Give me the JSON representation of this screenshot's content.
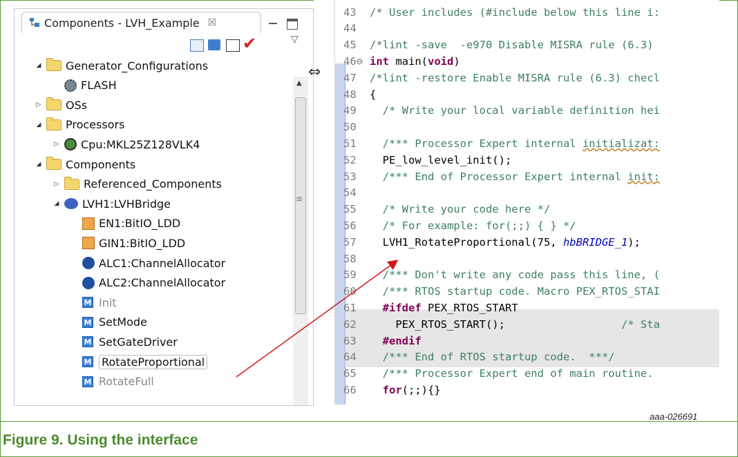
{
  "tab": {
    "title": "Components - LVH_Example",
    "close": "☒"
  },
  "toolbar": {
    "check": "✔",
    "menu": "▽"
  },
  "tree": [
    {
      "label": "Generator_Configurations",
      "type": "folder",
      "expand": "◢"
    },
    {
      "label": "FLASH",
      "type": "gear"
    },
    {
      "label": "OSs",
      "type": "folder",
      "expand": "▷"
    },
    {
      "label": "Processors",
      "type": "folder",
      "expand": "◢"
    },
    {
      "label": "Cpu:MKL25Z128VLK4",
      "type": "chip",
      "expand": "▷"
    },
    {
      "label": "Components",
      "type": "folder",
      "expand": "◢"
    },
    {
      "label": "Referenced_Components",
      "type": "folder",
      "expand": "▷"
    },
    {
      "label": "LVH1:LVHBridge",
      "type": "lvh",
      "expand": "◢"
    },
    {
      "label": "EN1:BitIO_LDD",
      "type": "bit"
    },
    {
      "label": "GIN1:BitIO_LDD",
      "type": "bit"
    },
    {
      "label": "ALC1:ChannelAllocator",
      "type": "used"
    },
    {
      "label": "ALC2:ChannelAllocator",
      "type": "used"
    },
    {
      "label": "Init",
      "type": "method"
    },
    {
      "label": "SetMode",
      "type": "method"
    },
    {
      "label": "SetGateDriver",
      "type": "method"
    },
    {
      "label": "RotateProportional",
      "type": "method"
    },
    {
      "label": "RotateFull",
      "type": "method"
    }
  ],
  "code": [
    {
      "n": "43",
      "t": "/* User includes (#include below this line i:"
    },
    {
      "n": "44",
      "t": ""
    },
    {
      "n": "45",
      "t": "/*lint -save  -e970 Disable MISRA rule (6.3)"
    },
    {
      "n": "46⊖",
      "t": "int main(void)"
    },
    {
      "n": "47",
      "t": "/*lint -restore Enable MISRA rule (6.3) checl"
    },
    {
      "n": "48",
      "t": "{"
    },
    {
      "n": "49",
      "t": "  /* Write your local variable definition hei"
    },
    {
      "n": "50",
      "t": ""
    },
    {
      "n": "51",
      "t": "  /*** Processor Expert internal initializat:"
    },
    {
      "n": "52",
      "t": "  PE_low_level_init();"
    },
    {
      "n": "53",
      "t": "  /*** End of Processor Expert internal init:"
    },
    {
      "n": "54",
      "t": ""
    },
    {
      "n": "55",
      "t": "  /* Write your code here */"
    },
    {
      "n": "56",
      "t": "  /* For example: for(;;) { } */"
    },
    {
      "n": "57",
      "t": "  LVH1_RotateProportional(75, hbBRIDGE_1);"
    },
    {
      "n": "58",
      "t": ""
    },
    {
      "n": "59",
      "t": "  /*** Don't write any code pass this line, ("
    },
    {
      "n": "60",
      "t": "  /*** RTOS startup code. Macro PEX_RTOS_STAI"
    },
    {
      "n": "61",
      "t": "  #ifdef PEX_RTOS_START"
    },
    {
      "n": "62",
      "t": "    PEX_RTOS_START();                  /* Sta"
    },
    {
      "n": "63",
      "t": "  #endif"
    },
    {
      "n": "64",
      "t": "  /*** End of RTOS startup code.  ***/"
    },
    {
      "n": "65",
      "t": "  /*** Processor Expert end of main routine."
    },
    {
      "n": "66",
      "t": "  for(;;){}"
    }
  ],
  "code_parts": {
    "int_kw": "int",
    "main_text": " main(",
    "void_kw": "void",
    "close_paren": ")",
    "call_prefix": "  LVH1_RotateProportional(75, ",
    "call_var": "hbBRIDGE_1",
    "call_suffix": ");",
    "ifdef_kw": "  #ifdef",
    "ifdef_rest": " PEX_RTOS_START",
    "endif_kw": "  #endif",
    "for_kw": "  for",
    "for_rest": "(;;){}",
    "pe_call": "  PE_low_level_init();",
    "brace": "{",
    "pex_start": "    PEX_RTOS_START();                  ",
    "pex_comment": "/* Sta"
  },
  "caption": {
    "id": "aaa-026691",
    "title": "Figure 9. Using the interface"
  }
}
